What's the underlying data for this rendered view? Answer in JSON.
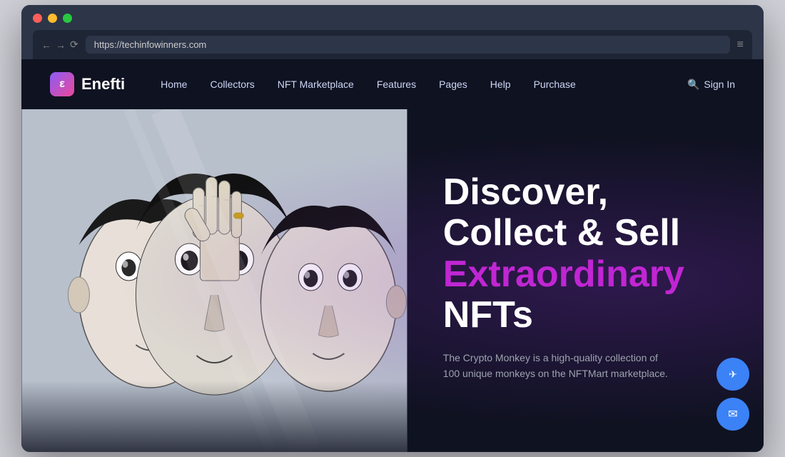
{
  "browser": {
    "url": "https://techinfowinners.com",
    "menu_icon": "≡"
  },
  "nav": {
    "logo_letter": "ε",
    "logo_name": "Enefti",
    "links": [
      {
        "label": "Home",
        "id": "home"
      },
      {
        "label": "Collectors",
        "id": "collectors"
      },
      {
        "label": "NFT Marketplace",
        "id": "nft-marketplace"
      },
      {
        "label": "Features",
        "id": "features"
      },
      {
        "label": "Pages",
        "id": "pages"
      },
      {
        "label": "Help",
        "id": "help"
      },
      {
        "label": "Purchase",
        "id": "purchase"
      }
    ],
    "sign_in": "Sign In"
  },
  "hero": {
    "title_line1": "Discover,",
    "title_line2": "Collect & Sell",
    "title_highlight": "Extraordinary",
    "title_line3": " NFTs",
    "description": "The Crypto Monkey is a high-quality collection of 100 unique monkeys on the NFTMart marketplace."
  },
  "floating": {
    "telegram_icon": "✈",
    "email_icon": "✉"
  },
  "scroll": {
    "dots": [
      false,
      true,
      false
    ]
  }
}
